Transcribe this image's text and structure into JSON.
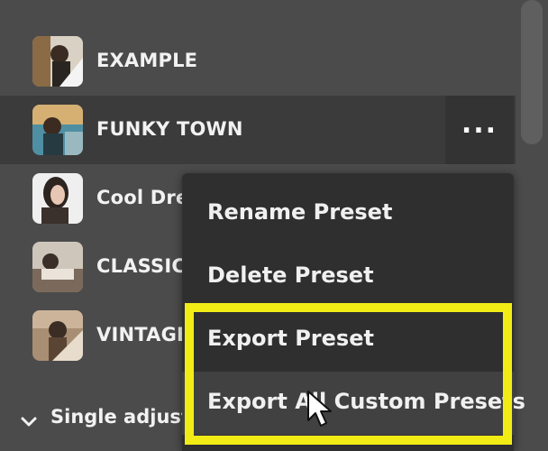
{
  "presets": [
    {
      "name": "EXAMPLE"
    },
    {
      "name": "FUNKY TOWN"
    },
    {
      "name": "Cool Dre"
    },
    {
      "name": "CLASSIC"
    },
    {
      "name": "VINTAGE"
    }
  ],
  "more_button": {
    "label": "..."
  },
  "group": {
    "label": "Single adjustr"
  },
  "context_menu": {
    "items": [
      {
        "label": "Rename Preset"
      },
      {
        "label": "Delete Preset"
      },
      {
        "label": "Export Preset"
      },
      {
        "label": "Export All Custom Presets"
      }
    ]
  },
  "colors": {
    "panel_bg": "#4b4b4b",
    "selected_row": "#3b3b3b",
    "menu_bg": "#2f2f2f",
    "menu_hover": "#414141",
    "highlight": "#f2ec16"
  }
}
